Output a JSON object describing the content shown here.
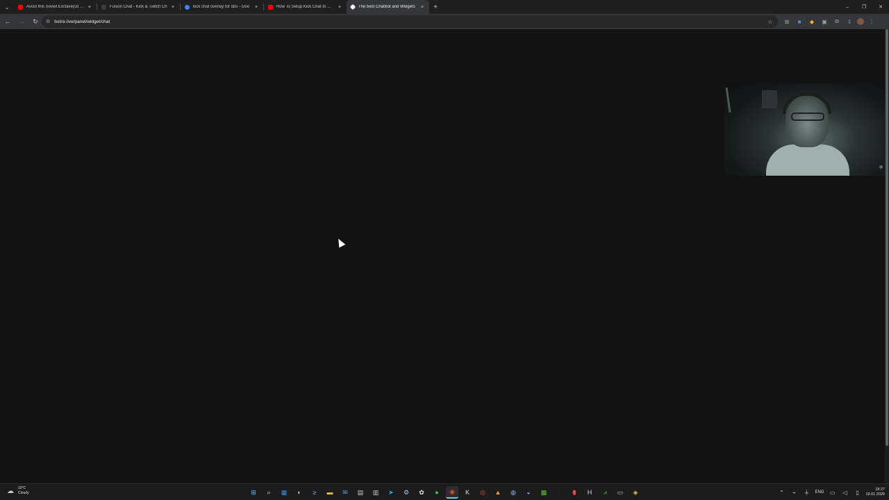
{
  "browser": {
    "tabs": [
      {
        "title": "Avoid this Soviet Exclave(so - Y",
        "favicon_color": "#ff0000",
        "active": false
      },
      {
        "title": "Fusion Chat - Kick & Twitch Ch",
        "favicon_color": "#2c2c2c",
        "active": false
      },
      {
        "title": "kick chat overlay for obs - Goo",
        "favicon_color": "#4285f4",
        "active": false
      },
      {
        "title": "How To Setup Kick Chat In OBS",
        "favicon_color": "#ff0000",
        "active": false
      },
      {
        "title": "The best ChatBot and Widgets",
        "favicon_color": "#ffffff",
        "active": true
      }
    ],
    "tab_close_label": "×",
    "new_tab_label": "+",
    "tab_menu_label": "⌄",
    "window_controls": {
      "minimize": "–",
      "maximize": "❐",
      "close": "✕"
    },
    "nav": {
      "back": "←",
      "forward": "→",
      "reload": "↻"
    },
    "url": "botrix.live/panel/widget/chat",
    "site_icon": "⚙",
    "bookmark_icon": "☆"
  },
  "extensions": [
    "puzzle-icon",
    "ext-blue-icon",
    "ext-yellow-icon",
    "sidebar-icon",
    "extensions-icon",
    "downloads-icon",
    "profile-icon"
  ],
  "taskbar": {
    "weather": {
      "temp": "10°C",
      "condition": "Cloudy"
    },
    "apps": [
      "windows-start-icon",
      "search-icon",
      "widgets-icon",
      "copilot-icon",
      "terminal-icon",
      "file-explorer-icon",
      "mail-icon",
      "notepad-icon",
      "calendar-icon",
      "telegram-icon",
      "steam-icon",
      "chatgpt-icon",
      "spotify-icon",
      "chrome-icon",
      "kick-icon",
      "obs-icon",
      "brave-icon",
      "browser-icon",
      "discord-icon",
      "minecraft-icon",
      "app-icon",
      "record-icon",
      "h-icon",
      "chart-icon",
      "taskmanager-icon",
      "gallery-icon"
    ],
    "tray": {
      "language": "ENG",
      "time": "18:27",
      "date": "19.01.2026"
    }
  }
}
